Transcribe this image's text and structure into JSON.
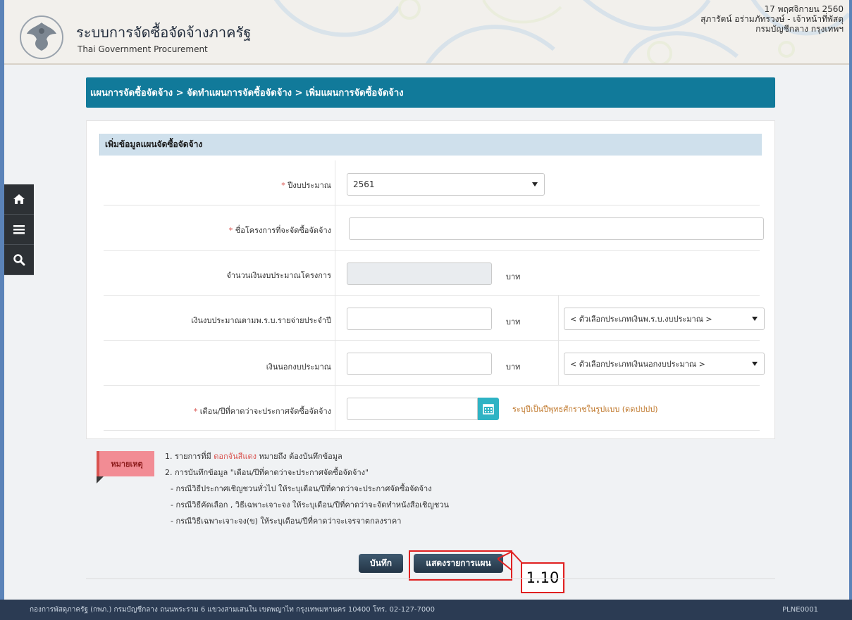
{
  "header": {
    "title_th": "ระบบการจัดซื้อจัดจ้างภาครัฐ",
    "title_en": "Thai Government Procurement",
    "date": "17 พฤศจิกายน 2560",
    "user": "สุภารัตน์ อร่ามภัทรวงษ์ - เจ้าหน้าที่พัสดุ",
    "org": "กรมบัญชีกลาง กรุงเทพฯ"
  },
  "sidebar": {
    "items": [
      "home-icon",
      "menu-icon",
      "search-icon"
    ]
  },
  "breadcrumb": "แผนการจัดซื้อจัดจ้าง > จัดทำแผนการจัดซื้อจัดจ้าง > เพิ่มแผนการจัดซื้อจัดจ้าง",
  "form": {
    "title": "เพิ่มข้อมูลแผนจัดซื้อจัดจ้าง",
    "required_mark": "*",
    "fiscal_year_label": "ปีงบประมาณ",
    "fiscal_year_value": "2561",
    "project_name_label": "ชื่อโครงการที่จะจัดซื้อจัดจ้าง",
    "project_name_value": "",
    "budget_label": "จำนวนเงินงบประมาณโครงการ",
    "budget_value": "",
    "annual_budget_label": "เงินงบประมาณตามพ.ร.บ.รายจ่ายประจำปี",
    "annual_budget_value": "",
    "annual_budget_type": "< ตัวเลือกประเภทเงินพ.ร.บ.งบประมาณ >",
    "offbudget_label": "เงินนอกงบประมาณ",
    "offbudget_value": "",
    "offbudget_type": "< ตัวเลือกประเภทเงินนอกงบประมาณ >",
    "month_label": "เดือน/ปีที่คาดว่าจะประกาศจัดซื้อจัดจ้าง",
    "month_value": "",
    "month_hint": "ระบุปีเป็นปีพุทธศักราชในรูปแบบ (ดดปปปป)",
    "unit": "บาท"
  },
  "notes": {
    "tag": "หมายเหตุ",
    "line1_a": "1. รายการที่มี ",
    "line1_red": "ดอกจันสีแดง",
    "line1_b": " หมายถึง ต้องบันทึกข้อมูล",
    "line2": "2. การบันทึกข้อมูล \"เดือน/ปีที่คาดว่าจะประกาศจัดซื้อจัดจ้าง\"",
    "line3": "- กรณีวิธีประกาศเชิญชวนทั่วไป ให้ระบุเดือน/ปีที่คาดว่าจะประกาศจัดซื้อจัดจ้าง",
    "line4": "- กรณีวิธีคัดเลือก , วิธีเฉพาะเจาะจง ให้ระบุเดือน/ปีที่คาดว่าจะจัดทำหนังสือเชิญชวน",
    "line5": "- กรณีวิธีเฉพาะเจาะจง(ข) ให้ระบุเดือน/ปีที่คาดว่าจะเจรจาตกลงราคา"
  },
  "buttons": {
    "save": "บันทึก",
    "show_plan": "แสดงรายการแผน"
  },
  "callout": "1.10",
  "footer": {
    "address": "กองการพัสดุภาครัฐ (กพภ.) กรมบัญชีกลาง ถนนพระราม 6 แขวงสามเสนใน เขตพญาไท กรุงเทพมหานคร 10400 โทร. 02-127-7000",
    "code": "PLNE0001"
  }
}
